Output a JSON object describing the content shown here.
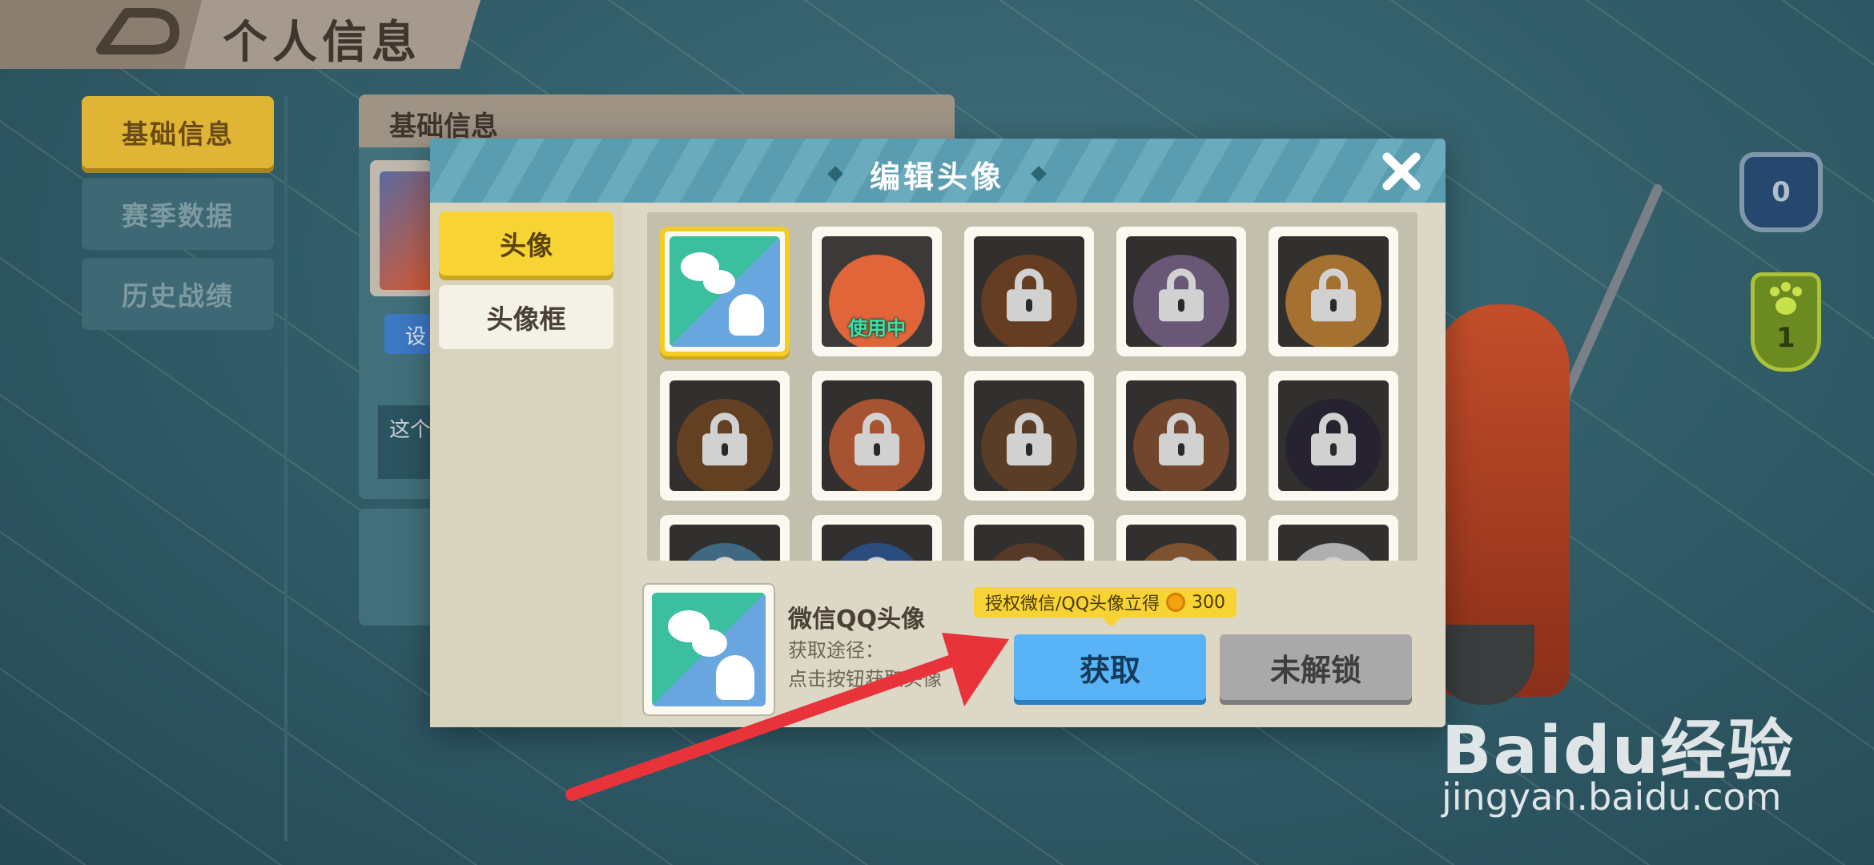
{
  "page": {
    "title": "个人信息",
    "back_icon": "back-arrow-icon"
  },
  "sidebar": {
    "items": [
      {
        "label": "基础信息",
        "active": true
      },
      {
        "label": "赛季数据",
        "active": false
      },
      {
        "label": "历史战绩",
        "active": false
      }
    ]
  },
  "info_panel": {
    "header": "基础信息",
    "button_label": "设",
    "text_snippet": "这个"
  },
  "right_panel": {
    "shield_count": "0",
    "paw_count": "1"
  },
  "dialog": {
    "title": "编辑头像",
    "close_icon": "close-icon",
    "tabs": [
      {
        "label": "头像",
        "active": true
      },
      {
        "label": "头像框",
        "active": false
      }
    ],
    "grid": {
      "rows": [
        [
          {
            "name": "wechat-qq",
            "color": "#3bbf9e",
            "selected": true,
            "locked": false,
            "badge": ""
          },
          {
            "name": "fox",
            "color": "#e0663a",
            "selected": false,
            "locked": false,
            "badge": "使用中"
          },
          {
            "name": "bear",
            "color": "#7a4a2a",
            "selected": false,
            "locked": true,
            "badge": ""
          },
          {
            "name": "cat-purple",
            "color": "#7f6b8f",
            "selected": false,
            "locked": true,
            "badge": ""
          },
          {
            "name": "tiger",
            "color": "#c98a3c",
            "selected": false,
            "locked": true,
            "badge": ""
          }
        ],
        [
          {
            "name": "deer",
            "color": "#7a4e2a",
            "selected": false,
            "locked": true,
            "badge": ""
          },
          {
            "name": "fox-cat",
            "color": "#c9653a",
            "selected": false,
            "locked": true,
            "badge": ""
          },
          {
            "name": "dog",
            "color": "#6e4a30",
            "selected": false,
            "locked": true,
            "badge": ""
          },
          {
            "name": "rabbit",
            "color": "#8a5536",
            "selected": false,
            "locked": true,
            "badge": ""
          },
          {
            "name": "dark-cat",
            "color": "#2e2a3a",
            "selected": false,
            "locked": true,
            "badge": ""
          }
        ],
        [
          {
            "name": "shark",
            "color": "#4d7fa0",
            "selected": false,
            "locked": true,
            "badge": ""
          },
          {
            "name": "bird",
            "color": "#355e98",
            "selected": false,
            "locked": true,
            "badge": ""
          },
          {
            "name": "bear-2",
            "color": "#6a4630",
            "selected": false,
            "locked": true,
            "badge": ""
          },
          {
            "name": "hamster",
            "color": "#9a6438",
            "selected": false,
            "locked": true,
            "badge": ""
          },
          {
            "name": "rooster",
            "color": "#d6d6d6",
            "selected": false,
            "locked": true,
            "badge": ""
          }
        ]
      ]
    },
    "detail": {
      "name": "微信QQ头像",
      "source_label": "获取途径：",
      "source_text": "点击按钮获取头像",
      "tooltip": "授权微信/QQ头像立得",
      "reward": "300",
      "reward_icon": "coin-icon",
      "get_button": "获取",
      "locked_button": "未解锁"
    }
  },
  "watermark": {
    "logo": "Baidu经验",
    "url": "jingyan.baidu.com"
  },
  "colors": {
    "accent_yellow": "#f7d433",
    "get_blue": "#58b4f6",
    "header_blue": "#5a9cb0",
    "arrow_red": "#e8333a"
  }
}
